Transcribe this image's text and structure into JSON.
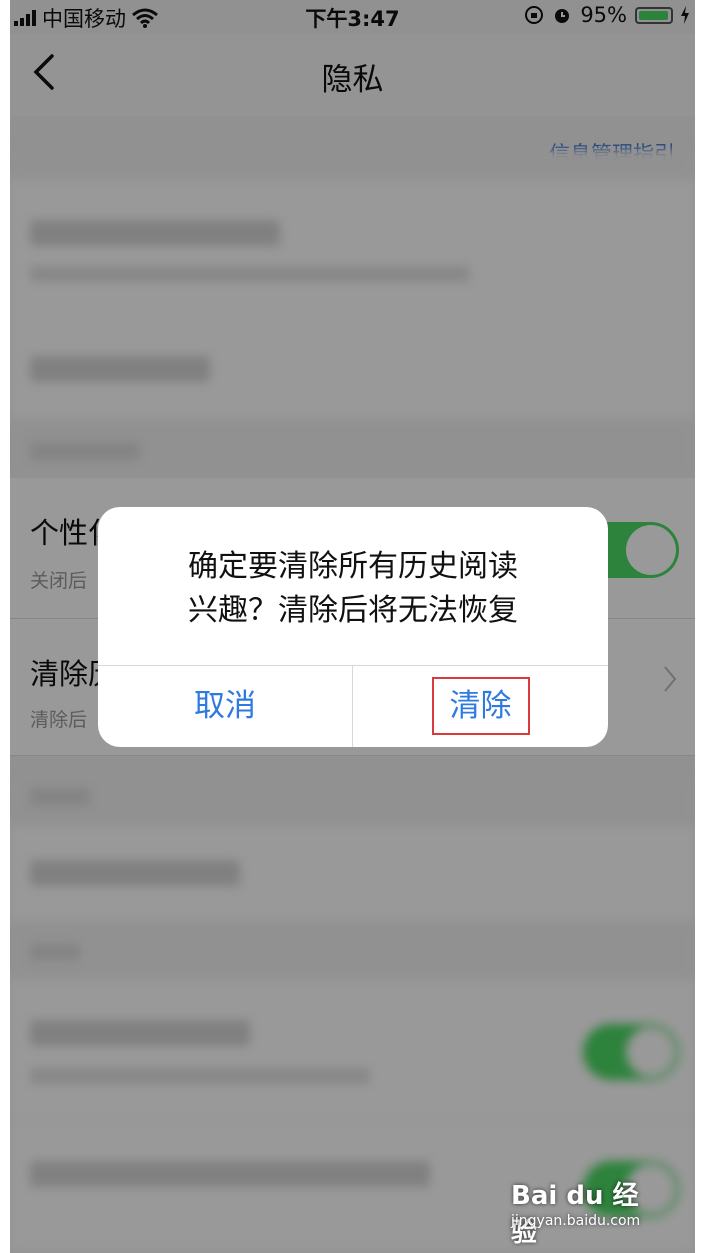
{
  "status_bar": {
    "carrier": "中国移动",
    "time": "下午3:47",
    "battery_percent": "95%",
    "battery_level": 0.95,
    "icons": [
      "signal-icon",
      "wifi-icon",
      "rotation-lock-icon",
      "alarm-icon",
      "battery-icon",
      "charging-icon"
    ]
  },
  "nav": {
    "back_icon": "chevron-left-icon",
    "title": "隐私"
  },
  "background": {
    "section_header_link": "信息管理指引",
    "visible_row_title_fragments": [
      "个性化",
      "清除历"
    ],
    "visible_row_subtitle_fragments": [
      "关闭后",
      "清除后"
    ]
  },
  "dialog": {
    "message_line1": "确定要清除所有历史阅读",
    "message_line2": "兴趣？清除后将无法恢复",
    "cancel_label": "取消",
    "confirm_label": "清除",
    "confirm_highlight_color": "#d93a3a"
  },
  "watermark": {
    "brand": "Bai du 经验",
    "url": "jingyan.baidu.com"
  },
  "colors": {
    "accent_blue": "#2f7ae0",
    "toggle_green": "#4cd964"
  }
}
